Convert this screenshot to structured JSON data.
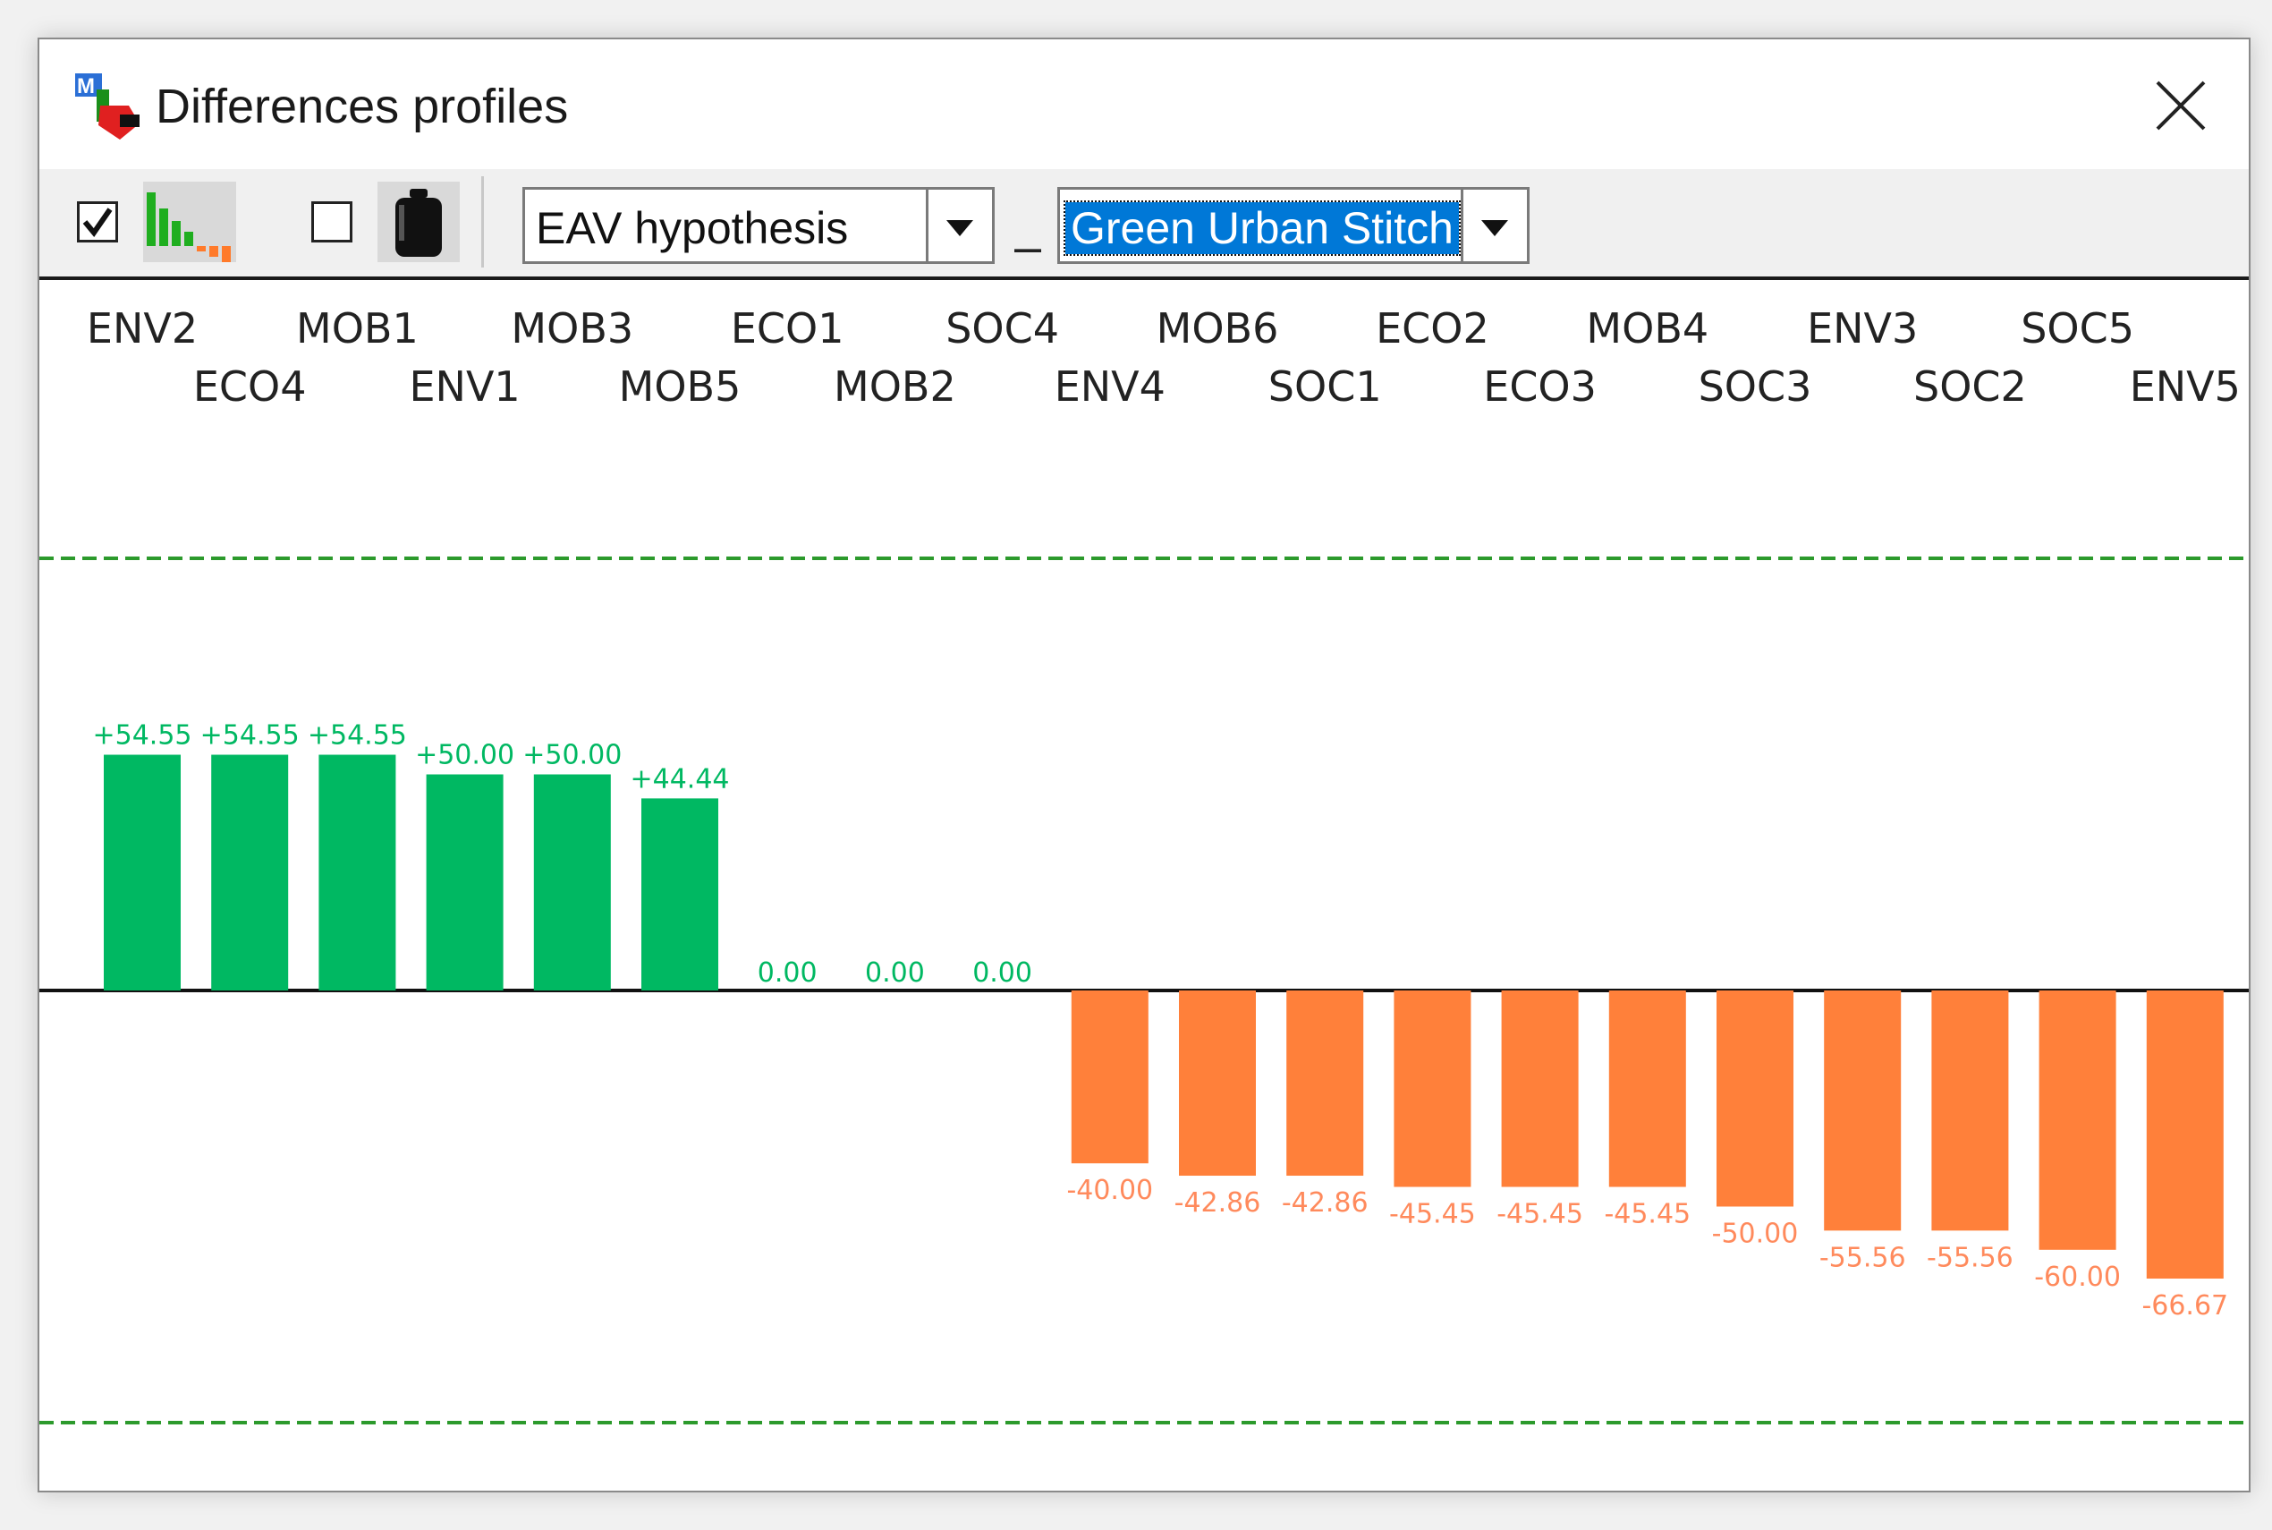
{
  "window": {
    "title": "Differences profiles",
    "app_icon": "multicriteria-app-icon",
    "close_icon": "close-icon"
  },
  "toolbar": {
    "show_profile_checkbox": {
      "checked": true,
      "icon": "bar-profile-icon"
    },
    "show_weights_checkbox": {
      "checked": false,
      "icon": "weight-icon"
    },
    "left_combo_value": "EAV hypothesis",
    "separator": "–",
    "right_combo_value": "Green Urban Stitch"
  },
  "colors": {
    "positive": "#00b862",
    "negative": "#ff803a",
    "positive_label": "#00b862",
    "negative_label": "#ff8a5c",
    "threshold_line": "#2c9a2c",
    "baseline": "#111111",
    "selection": "#0078d7"
  },
  "chart_data": {
    "type": "bar",
    "categories": [
      "ENV2",
      "ECO4",
      "MOB1",
      "ENV1",
      "MOB3",
      "MOB5",
      "ECO1",
      "MOB2",
      "SOC4",
      "ENV4",
      "MOB6",
      "SOC1",
      "ECO2",
      "ECO3",
      "MOB4",
      "SOC3",
      "ENV3",
      "SOC2",
      "SOC5",
      "ENV5"
    ],
    "values": [
      54.55,
      54.55,
      54.55,
      50.0,
      50.0,
      44.44,
      0.0,
      0.0,
      0.0,
      -40.0,
      -42.86,
      -42.86,
      -45.45,
      -45.45,
      -45.45,
      -50.0,
      -55.56,
      -55.56,
      -60.0,
      -66.67
    ],
    "value_labels": [
      "+54.55",
      "+54.55",
      "+54.55",
      "+50.00",
      "+50.00",
      "+44.44",
      "0.00",
      "0.00",
      "0.00",
      "-40.00",
      "-42.86",
      "-42.86",
      "-45.45",
      "-45.45",
      "-45.45",
      "-50.00",
      "-55.56",
      "-55.56",
      "-60.00",
      "-66.67"
    ],
    "ylim": [
      -100,
      100
    ],
    "threshold_lines": [
      100,
      -100
    ],
    "grid": false,
    "xlabel": "",
    "ylabel": ""
  }
}
